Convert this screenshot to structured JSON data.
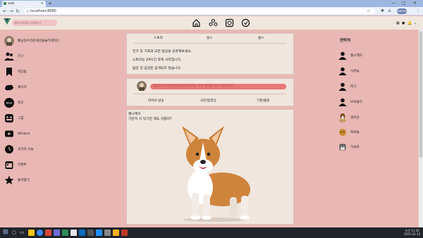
{
  "browser": {
    "tab_title": "vue",
    "new_tab": "+",
    "url": "localhost:8080",
    "profile_label": "업데이트 :",
    "window_controls": {
      "minimize": "—",
      "maximize": "□",
      "close": "✕"
    }
  },
  "header": {
    "search_placeholder": "페이스북에서 검색하기",
    "brand_color": "#3b8a5a"
  },
  "left_sidebar": {
    "items": [
      {
        "label": "황금똥수리온세상을놀라게하다",
        "icon": "user-avatar-icon"
      },
      {
        "label": "친구",
        "icon": "friends-icon"
      },
      {
        "label": "저장됨",
        "icon": "bookmark-icon"
      },
      {
        "label": "페이지",
        "icon": "flag-icon"
      },
      {
        "label": "최신",
        "icon": "new-badge-icon"
      },
      {
        "label": "그룹",
        "icon": "group-icon"
      },
      {
        "label": "Whatch",
        "icon": "play-icon"
      },
      {
        "label": "과거의 오늘",
        "icon": "clock-icon"
      },
      {
        "label": "이벤트",
        "icon": "calendar-icon"
      },
      {
        "label": "즐겨찾기",
        "icon": "star-icon"
      }
    ]
  },
  "story_card": {
    "tabs": [
      "스토리",
      "릴스",
      "룸스"
    ],
    "lines": [
      "친구 및 가족과 모든 일상을 공유해보세요.",
      "스토리는 24시간 후에 사라집니다.",
      "답장 및 공감은 공개되지 않습니다."
    ]
  },
  "composer": {
    "placeholder": "황금똥수리온세상을놀라게하다님, 무슨 생각을 하고 계신가요?",
    "actions": [
      "라이브 방송",
      "사진/동영상",
      "기분/활동"
    ]
  },
  "post": {
    "author": "월시케이",
    "text": "가만히 서 있기만 해도 귀엽지?"
  },
  "contacts": {
    "title": "연락처",
    "items": [
      "웰시케이",
      "시바늉",
      "퍼그",
      "브로콜리",
      "검비글",
      "좌루돌",
      "하숙희"
    ]
  },
  "taskbar": {
    "time": "오전 11:30",
    "date": "2021-05-13"
  }
}
